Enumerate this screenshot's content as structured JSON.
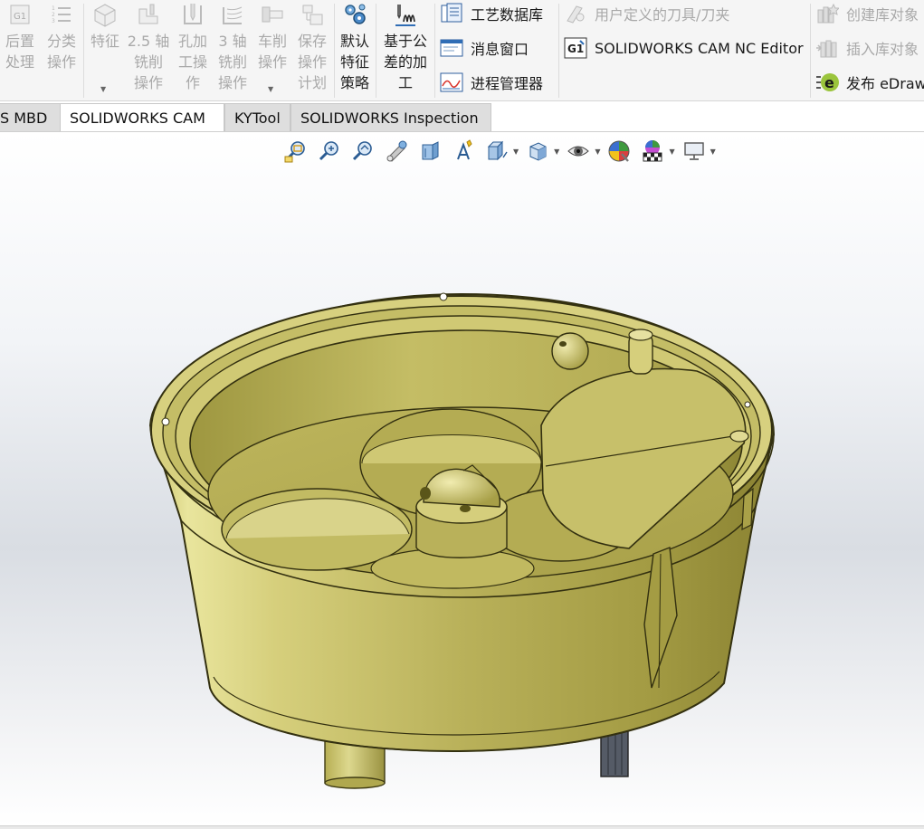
{
  "ribbon": {
    "left_buttons": [
      {
        "name": "post-process",
        "label": "后置\n处理",
        "icon": "g1-icon",
        "enabled": false
      },
      {
        "name": "classify-ops",
        "label": "分类\n操作",
        "icon": "numbered-list-icon",
        "enabled": false
      },
      {
        "name": "feature",
        "label": "特征",
        "icon": "cube-icon",
        "enabled": false
      },
      {
        "name": "mill-25-axis",
        "label": "2.5 轴\n铣削\n操作",
        "icon": "mill-25-icon",
        "enabled": false
      },
      {
        "name": "hole-ops",
        "label": "孔加\n工操\n作",
        "icon": "drill-icon",
        "enabled": false
      },
      {
        "name": "mill-3-axis",
        "label": "3 轴\n铣削\n操作",
        "icon": "mill-3-icon",
        "enabled": false
      },
      {
        "name": "turn-ops",
        "label": "车削\n操作",
        "icon": "lathe-icon",
        "enabled": false
      },
      {
        "name": "save-op-plan",
        "label": "保存\n操作\n计划",
        "icon": "save-plan-icon",
        "enabled": false
      },
      {
        "name": "default-strategy",
        "label": "默认\n特征\n策略",
        "icon": "gears-icon",
        "enabled": true
      },
      {
        "name": "tolerance-machining",
        "label": "基于公\n差的加\n工",
        "icon": "tolerance-icon",
        "enabled": true
      }
    ],
    "mid_items": [
      {
        "name": "tech-database",
        "label": "工艺数据库",
        "icon": "database-icon",
        "enabled": true
      },
      {
        "name": "message-window",
        "label": "消息窗口",
        "icon": "message-window-icon",
        "enabled": true
      },
      {
        "name": "process-manager",
        "label": "进程管理器",
        "icon": "process-manager-icon",
        "enabled": true
      }
    ],
    "right_items": [
      {
        "name": "user-tool-holder",
        "label": "用户定义的刀具/刀夹",
        "icon": "tool-icon",
        "enabled": false
      },
      {
        "name": "nc-editor",
        "label": "SOLIDWORKS CAM NC Editor",
        "icon": "nc-editor-icon",
        "enabled": true
      }
    ],
    "far_items": [
      {
        "name": "create-library-object",
        "label": "创建库对象",
        "icon": "library-create-icon",
        "enabled": false
      },
      {
        "name": "insert-library-object",
        "label": "插入库对象",
        "icon": "library-insert-icon",
        "enabled": false
      },
      {
        "name": "publish-edrawings",
        "label": "发布 eDraw",
        "icon": "edrawings-icon",
        "enabled": true
      }
    ]
  },
  "tabs": [
    {
      "label": "S MBD",
      "active": false
    },
    {
      "label": "SOLIDWORKS CAM",
      "active": true
    },
    {
      "label": "KYTool",
      "active": false
    },
    {
      "label": "SOLIDWORKS Inspection",
      "active": false
    }
  ],
  "heads_up_toolbar": [
    {
      "name": "zoom-to-fit",
      "icon": "zoom-fit-icon",
      "dropdown": false
    },
    {
      "name": "zoom-to-area",
      "icon": "zoom-area-icon",
      "dropdown": false
    },
    {
      "name": "previous-view",
      "icon": "previous-view-icon",
      "dropdown": false
    },
    {
      "name": "section-view",
      "icon": "section-view-icon",
      "dropdown": false
    },
    {
      "name": "dynamic-annotation",
      "icon": "annotation-view-icon",
      "dropdown": false
    },
    {
      "name": "3d-view",
      "icon": "3d-view-icon",
      "dropdown": false
    },
    {
      "name": "view-orientation",
      "icon": "view-orientation-icon",
      "dropdown": true
    },
    {
      "name": "display-style",
      "icon": "display-style-icon",
      "dropdown": true
    },
    {
      "name": "hide-show",
      "icon": "eye-icon",
      "dropdown": true
    },
    {
      "name": "edit-appearance",
      "icon": "appearance-icon",
      "dropdown": false
    },
    {
      "name": "apply-scene",
      "icon": "scene-icon",
      "dropdown": true
    },
    {
      "name": "view-settings",
      "icon": "monitor-icon",
      "dropdown": true
    }
  ],
  "colors": {
    "model_body": "#c9c26a",
    "model_shadow": "#6f6a22",
    "model_highlight": "#efeba7",
    "tab_active": "#ffffff",
    "tab_inactive": "#dedede"
  }
}
